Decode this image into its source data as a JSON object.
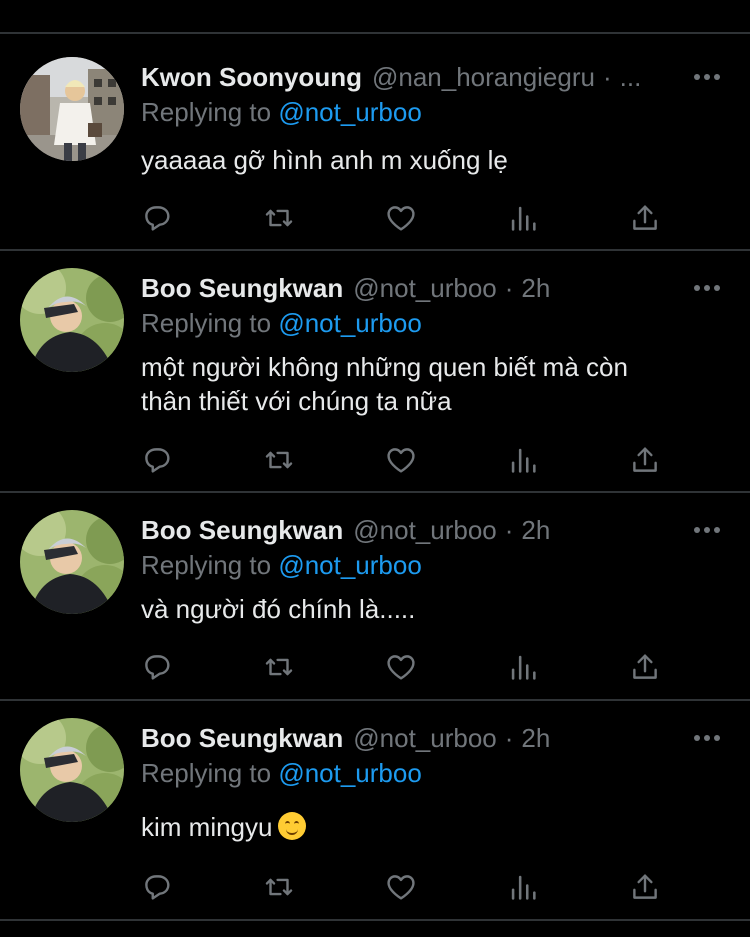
{
  "tweets": [
    {
      "name": "Kwon Soonyoung",
      "handle": "@nan_horangiegru",
      "separator": "·",
      "time": "...",
      "reply_prefix": "Replying to",
      "reply_to": "@not_urboo",
      "lines": [
        "yaaaaa gỡ hình anh m xuống lẹ"
      ],
      "avatar_icon": "profile-photo-street"
    },
    {
      "name": "Boo Seungkwan",
      "handle": "@not_urboo",
      "separator": "·",
      "time": "2h",
      "reply_prefix": "Replying to",
      "reply_to": "@not_urboo",
      "lines": [
        "một người không những quen biết mà còn",
        "thân thiết với chúng ta nữa"
      ],
      "avatar_icon": "profile-photo-grass"
    },
    {
      "name": "Boo Seungkwan",
      "handle": "@not_urboo",
      "separator": "·",
      "time": "2h",
      "reply_prefix": "Replying to",
      "reply_to": "@not_urboo",
      "lines": [
        "và người đó chính là....."
      ],
      "avatar_icon": "profile-photo-grass"
    },
    {
      "name": "Boo Seungkwan",
      "handle": "@not_urboo",
      "separator": "·",
      "time": "2h",
      "reply_prefix": "Replying to",
      "reply_to": "@not_urboo",
      "lines": [
        "kim mingyu"
      ],
      "emoji": "smiling-face-emoji",
      "avatar_icon": "profile-photo-grass"
    }
  ],
  "action_icons": [
    "reply-icon",
    "retweet-icon",
    "like-icon",
    "views-icon",
    "share-icon"
  ],
  "colors": {
    "background": "#000000",
    "text": "#e7e9ea",
    "muted": "#71767b",
    "accent": "#1d9bf0",
    "divider": "#2f3336"
  }
}
